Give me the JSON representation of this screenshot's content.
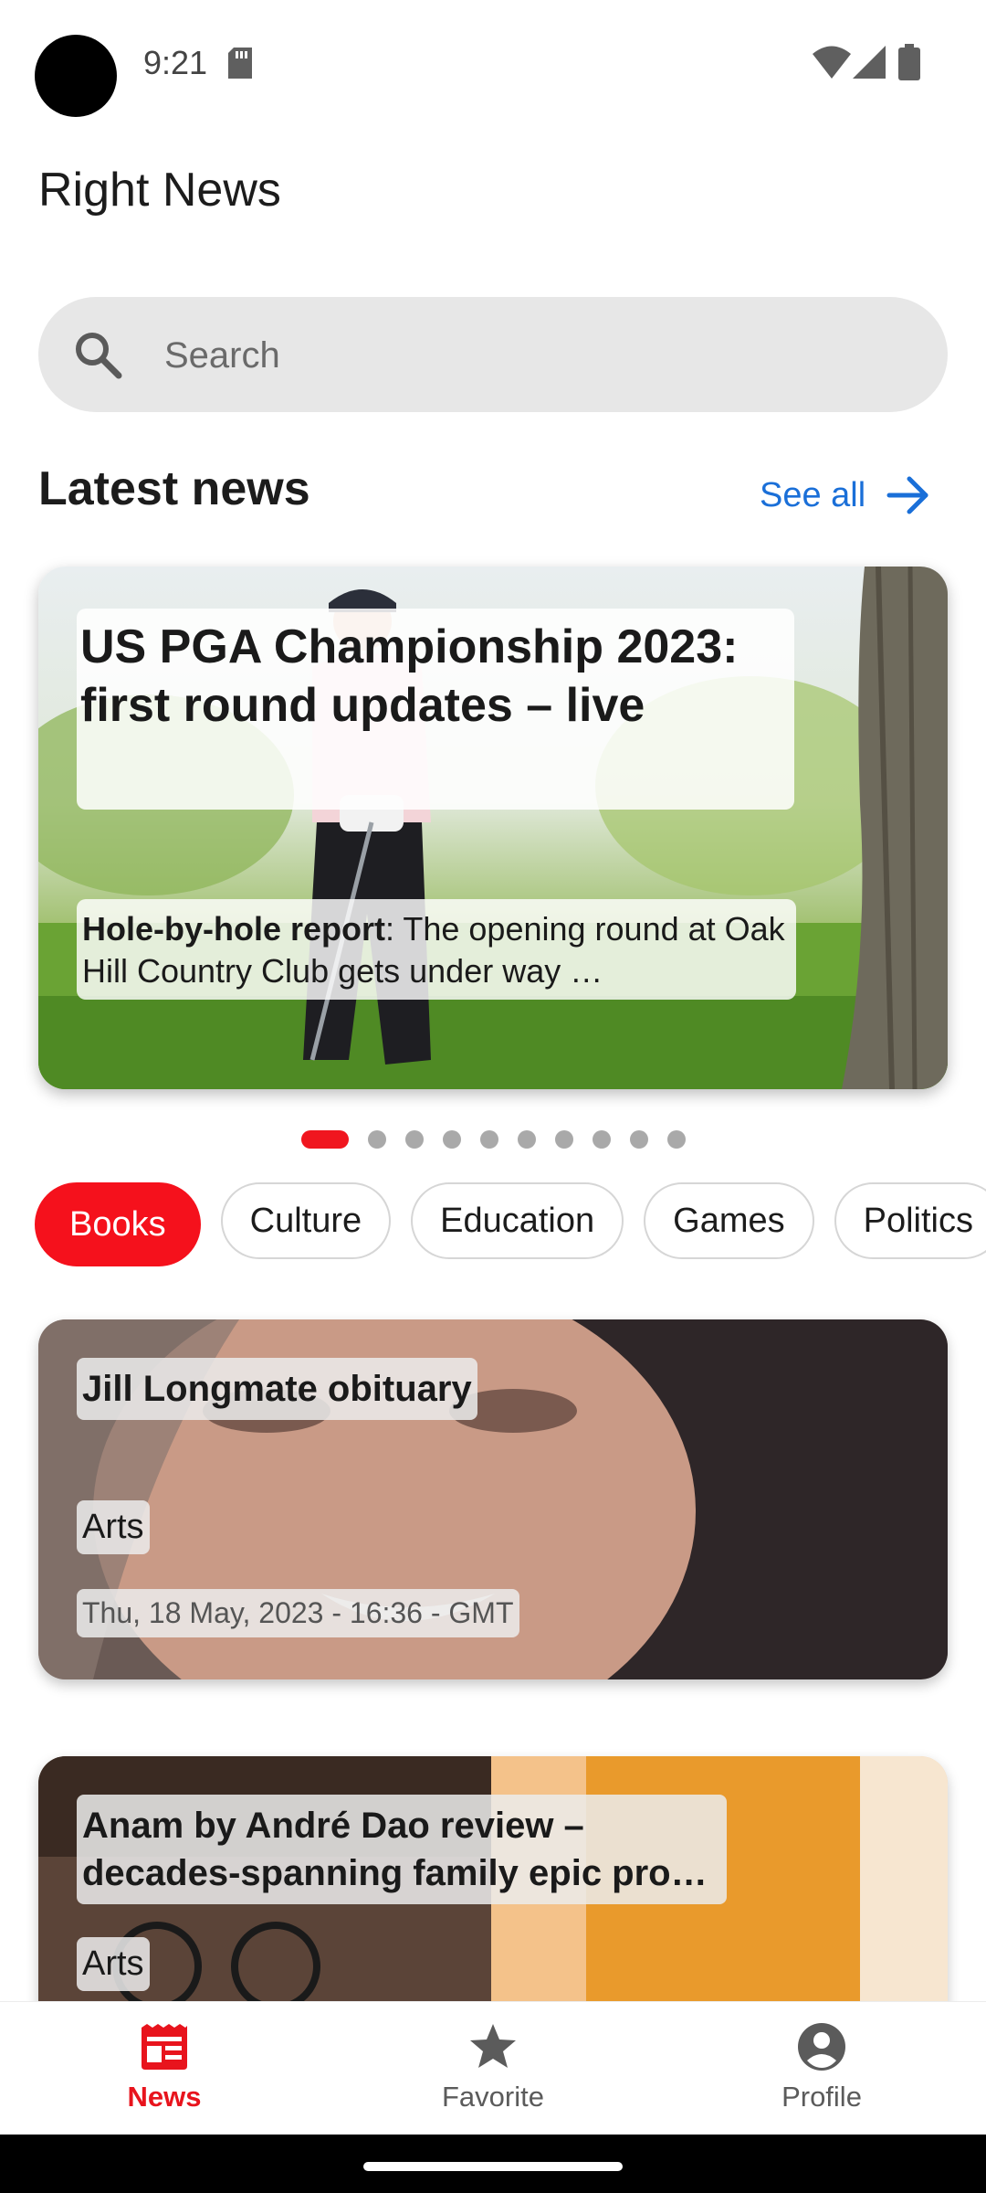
{
  "status": {
    "time": "9:21"
  },
  "app": {
    "title": "Right News"
  },
  "search": {
    "placeholder": "Search"
  },
  "latest": {
    "title": "Latest news",
    "see_all": "See all",
    "hero": {
      "headline": "US PGA Championship 2023: first round updates – live",
      "summary_bold": "Hole-by-hole report",
      "summary_rest": ": The opening round at Oak Hill Country Club gets under way …"
    },
    "pager": {
      "count": 10,
      "active_index": 0
    }
  },
  "categories": [
    {
      "label": "Books",
      "active": true
    },
    {
      "label": "Culture",
      "active": false
    },
    {
      "label": "Education",
      "active": false
    },
    {
      "label": "Games",
      "active": false
    },
    {
      "label": "Politics",
      "active": false
    }
  ],
  "articles": [
    {
      "title": "Jill Longmate obituary",
      "section": "Arts",
      "date": "Thu, 18 May, 2023 - 16:36 - GMT"
    },
    {
      "title": "Anam by André Dao review – decades-spanning family epic pro…",
      "section": "Arts"
    }
  ],
  "bottom_nav": [
    {
      "label": "News",
      "icon": "newspaper-icon",
      "active": true
    },
    {
      "label": "Favorite",
      "icon": "star-icon",
      "active": false
    },
    {
      "label": "Profile",
      "icon": "account-circle-icon",
      "active": false
    }
  ],
  "colors": {
    "accent_red": "#f5111c",
    "link_blue": "#1a6fd8",
    "search_bg": "#e7e7e7"
  }
}
